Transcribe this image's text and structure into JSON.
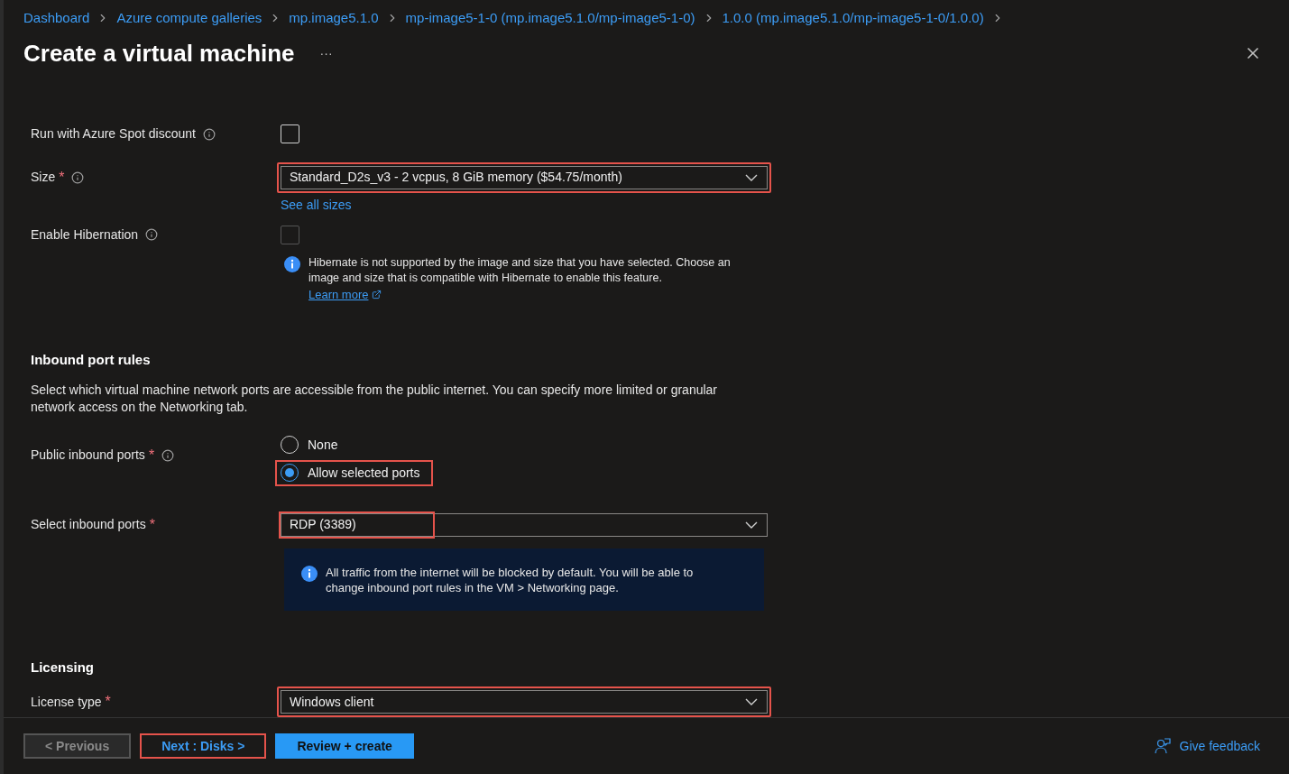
{
  "breadcrumbs": [
    "Dashboard",
    "Azure compute galleries",
    "mp.image5.1.0",
    "mp-image5-1-0 (mp.image5.1.0/mp-image5-1-0)",
    "1.0.0 (mp.image5.1.0/mp-image5-1-0/1.0.0)"
  ],
  "title": "Create a virtual machine",
  "more": "···",
  "spot": {
    "label": "Run with Azure Spot discount",
    "checked": false,
    "disabled": false
  },
  "size": {
    "label": "Size",
    "required": "*",
    "value": "Standard_D2s_v3 - 2 vcpus, 8 GiB memory ($54.75/month)",
    "highlighted": true,
    "link": "See all sizes"
  },
  "hibernation": {
    "label": "Enable Hibernation",
    "checked": false,
    "disabled": true,
    "note": "Hibernate is not supported by the image and size that you have selected. Choose an image and size that is compatible with Hibernate to enable this feature.",
    "note_link": "Learn more"
  },
  "inbound": {
    "heading": "Inbound port rules",
    "description": "Select which virtual machine network ports are accessible from the public internet. You can specify more limited or granular network access on the Networking tab.",
    "public_ports": {
      "label": "Public inbound ports",
      "required": "*",
      "options": [
        {
          "label": "None",
          "selected": false,
          "highlighted": false
        },
        {
          "label": "Allow selected ports",
          "selected": true,
          "highlighted": true
        }
      ]
    },
    "select_ports": {
      "label": "Select inbound ports",
      "required": "*",
      "value": "RDP (3389)",
      "value_highlighted": true
    },
    "note": "All traffic from the internet will be blocked by default. You will be able to change inbound port rules in the VM > Networking page."
  },
  "licensing": {
    "heading": "Licensing",
    "license_type": {
      "label": "License type",
      "required": "*",
      "value": "Windows client",
      "highlighted": true
    }
  },
  "footer": {
    "buttons": [
      {
        "label": "< Previous",
        "kind": "secondary",
        "disabled": true,
        "highlighted": false
      },
      {
        "label": "Next : Disks >",
        "kind": "secondary",
        "disabled": false,
        "highlighted": true
      },
      {
        "label": "Review + create",
        "kind": "primary",
        "disabled": false,
        "highlighted": false
      }
    ],
    "feedback": "Give feedback"
  }
}
